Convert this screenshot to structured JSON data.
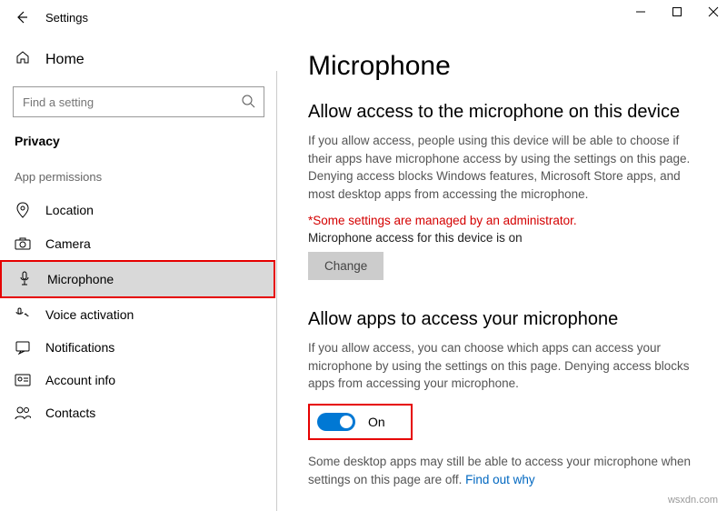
{
  "titlebar": {
    "app_title": "Settings"
  },
  "sidebar": {
    "home_label": "Home",
    "search_placeholder": "Find a setting",
    "category": "Privacy",
    "section_header": "App permissions",
    "items": [
      {
        "label": "Location"
      },
      {
        "label": "Camera"
      },
      {
        "label": "Microphone"
      },
      {
        "label": "Voice activation"
      },
      {
        "label": "Notifications"
      },
      {
        "label": "Account info"
      },
      {
        "label": "Contacts"
      }
    ]
  },
  "main": {
    "page_title": "Microphone",
    "section1_title": "Allow access to the microphone on this device",
    "section1_body": "If you allow access, people using this device will be able to choose if their apps have microphone access by using the settings on this page. Denying access blocks Windows features, Microsoft Store apps, and most desktop apps from accessing the microphone.",
    "admin_warning": "*Some settings are managed by an administrator.",
    "device_status": "Microphone access for this device is on",
    "change_label": "Change",
    "section2_title": "Allow apps to access your microphone",
    "section2_body": "If you allow access, you can choose which apps can access your microphone by using the settings on this page. Denying access blocks apps from accessing your microphone.",
    "toggle_label": "On",
    "footnote_text": "Some desktop apps may still be able to access your microphone when settings on this page are off. ",
    "footnote_link": "Find out why"
  },
  "watermark": "wsxdn.com"
}
